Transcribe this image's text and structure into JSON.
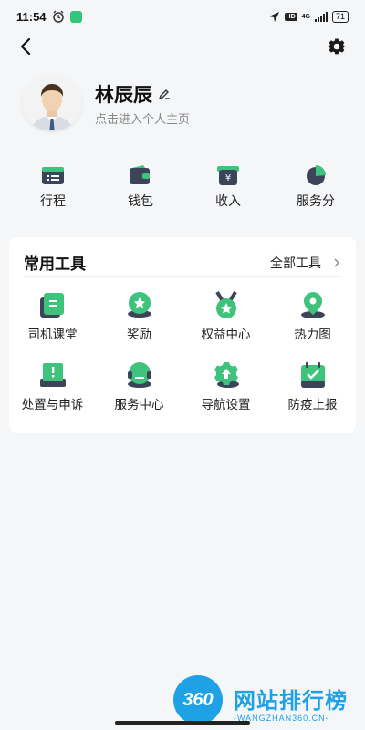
{
  "status_bar": {
    "time": "11:54",
    "network": "4G",
    "hd": "HD",
    "battery": "71"
  },
  "nav": {
    "back_icon": "back-arrow-icon",
    "settings_icon": "gear-icon"
  },
  "profile": {
    "name": "林辰辰",
    "subtitle": "点击进入个人主页",
    "edit_icon": "pencil-icon"
  },
  "quick_actions": [
    {
      "label": "行程",
      "icon": "trip-list-icon"
    },
    {
      "label": "钱包",
      "icon": "wallet-icon"
    },
    {
      "label": "收入",
      "icon": "income-icon"
    },
    {
      "label": "服务分",
      "icon": "service-score-icon"
    }
  ],
  "tools": {
    "title": "常用工具",
    "all_label": "全部工具",
    "items": [
      {
        "label": "司机课堂",
        "icon": "classroom-icon"
      },
      {
        "label": "奖励",
        "icon": "reward-icon"
      },
      {
        "label": "权益中心",
        "icon": "rights-medal-icon"
      },
      {
        "label": "热力图",
        "icon": "heatmap-pin-icon"
      },
      {
        "label": "处置与申诉",
        "icon": "appeal-icon"
      },
      {
        "label": "服务中心",
        "icon": "headset-icon"
      },
      {
        "label": "导航设置",
        "icon": "nav-settings-icon"
      },
      {
        "label": "防疫上报",
        "icon": "epidemic-report-icon"
      }
    ]
  },
  "colors": {
    "accent_green": "#3ec27c",
    "dark_navy": "#3b4459",
    "background": "#f5f6f8"
  },
  "watermark": {
    "badge": "360",
    "title": "网站排行榜",
    "url": "-WANGZHAN360.CN-"
  }
}
